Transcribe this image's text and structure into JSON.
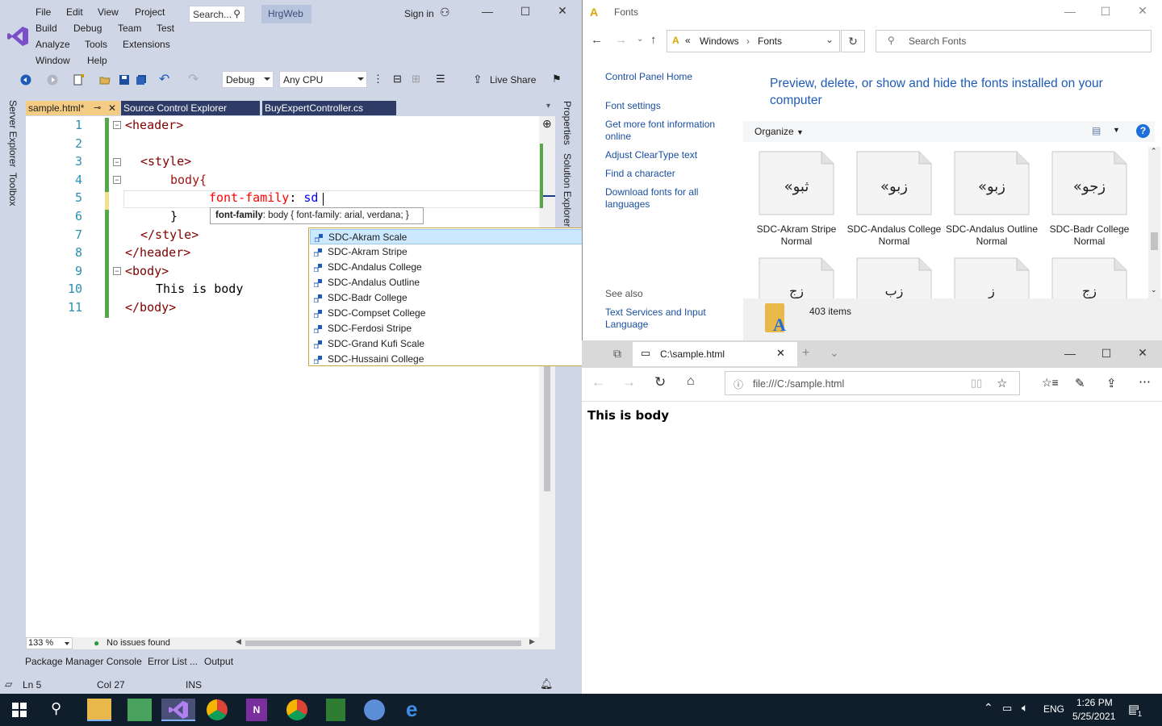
{
  "vs": {
    "menu": [
      "File",
      "Edit",
      "View",
      "Project",
      "Build",
      "Debug",
      "Team",
      "Test",
      "Analyze",
      "Tools",
      "Extensions",
      "Window",
      "Help"
    ],
    "search_placeholder": "Search...",
    "project_name": "HrgWeb",
    "sign_in": "Sign in",
    "config": "Debug",
    "platform": "Any CPU",
    "live_share": "Live Share",
    "left_panel": [
      "Server Explorer",
      "Toolbox"
    ],
    "right_panel": [
      "Properties",
      "Solution Explorer"
    ],
    "tabs": [
      "sample.html*",
      "Source Control Explorer",
      "BuyExpertController.cs"
    ],
    "lines": [
      {
        "n": "1",
        "parts": [
          [
            "tagc",
            "<header>"
          ]
        ]
      },
      {
        "n": "2",
        "parts": []
      },
      {
        "n": "3",
        "parts": [
          [
            "tagc",
            "<style>"
          ]
        ]
      },
      {
        "n": "4",
        "parts": [
          [
            "brown",
            "body{"
          ]
        ]
      },
      {
        "n": "5",
        "parts": [
          [
            "propc",
            "font-family"
          ],
          [
            "plain",
            ": "
          ],
          [
            "valc",
            "sd"
          ]
        ]
      },
      {
        "n": "6",
        "parts": [
          [
            "plain",
            "}"
          ]
        ]
      },
      {
        "n": "7",
        "parts": [
          [
            "tagc",
            "</style>"
          ]
        ]
      },
      {
        "n": "8",
        "parts": [
          [
            "tagc",
            "</header>"
          ]
        ]
      },
      {
        "n": "9",
        "parts": [
          [
            "tagc",
            "<body>"
          ]
        ]
      },
      {
        "n": "10",
        "parts": [
          [
            "plain",
            "This is body"
          ]
        ]
      },
      {
        "n": "11",
        "parts": [
          [
            "tagc",
            "</body>"
          ]
        ]
      }
    ],
    "tooltip_prop": "font-family",
    "tooltip_rest": ": body { font-family: arial, verdana; }",
    "completions": [
      "SDC-Akram Scale",
      "SDC-Akram Stripe",
      "SDC-Andalus College",
      "SDC-Andalus Outline",
      "SDC-Badr College",
      "SDC-Compset College",
      "SDC-Ferdosi Stripe",
      "SDC-Grand Kufi Scale",
      "SDC-Hussaini College"
    ],
    "zoom": "133 %",
    "issues": "No issues found",
    "bottom_tabs": [
      "Package Manager Console",
      "Error List ...",
      "Output"
    ],
    "status": {
      "ln": "Ln 5",
      "col": "Col 27",
      "ins": "INS"
    }
  },
  "explorer": {
    "title": "Fonts",
    "breadcrumb": [
      "Windows",
      "Fonts"
    ],
    "search_placeholder": "Search Fonts",
    "nav": [
      "Control Panel Home",
      "Font settings",
      "Get more font information online",
      "Adjust ClearType text",
      "Find a character",
      "Download fonts for all languages"
    ],
    "see_also": "See also",
    "see_also_link": "Text Services and Input Language",
    "headline": "Preview, delete, or show and hide the fonts installed on your computer",
    "organize": "Organize",
    "fonts": [
      {
        "name": "SDC-Akram Stripe Normal",
        "glyph": "«ثبو"
      },
      {
        "name": "SDC-Andalus College Normal",
        "glyph": "«زبو"
      },
      {
        "name": "SDC-Andalus Outline Normal",
        "glyph": "«زبو"
      },
      {
        "name": "SDC-Badr College Normal",
        "glyph": "«زجو"
      }
    ],
    "row2_glyphs": [
      "زج",
      "زب",
      "ز",
      "زج"
    ],
    "item_count": "403 items"
  },
  "edge": {
    "tab_title": "C:\\sample.html",
    "url": "file:///C:/sample.html",
    "body_text": "This is body"
  },
  "taskbar": {
    "lang": "ENG",
    "time": "1:26 PM",
    "date": "5/25/2021",
    "notif_count": "1"
  }
}
